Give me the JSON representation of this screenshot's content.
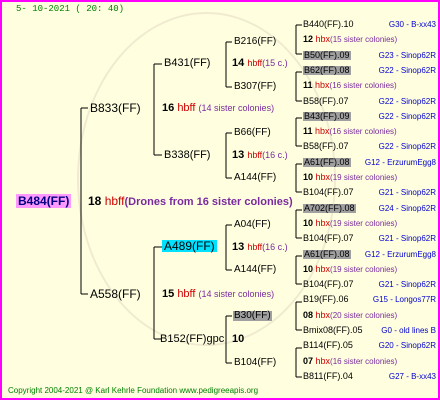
{
  "date": "5- 10-2021 ( 20: 40)",
  "root": {
    "name": "B484(FF)",
    "num": "18",
    "hb": "hbff",
    "note": "(Drones from 16 sister colonies)"
  },
  "g1": [
    {
      "name": "B833(FF)",
      "num": "16",
      "hb": "hbff",
      "note": "(14 sister colonies)"
    },
    {
      "name": "A558(FF)",
      "num": "15",
      "hb": "hbff",
      "note": "(14 sister colonies)"
    }
  ],
  "g2": [
    {
      "name": "B431(FF)",
      "num": "14",
      "hb": "hbff",
      "note": "(15 c.)"
    },
    {
      "name": "B338(FF)",
      "num": "13",
      "hb": "hbff",
      "note": "(16 c.)"
    },
    {
      "name": "A489(FF)",
      "num": "13",
      "hb": "hbff",
      "note": "(16 c.)"
    },
    {
      "name": "B152(FF)gpc",
      "num": "10",
      "hb": "",
      "note": ""
    }
  ],
  "g3": [
    {
      "name": "B216(FF)"
    },
    {
      "name": "B307(FF)"
    },
    {
      "name": "B66(FF)"
    },
    {
      "name": "A144(FF)"
    },
    {
      "name": "A04(FF)"
    },
    {
      "name": "A144(FF)"
    },
    {
      "name": "B30(FF)"
    },
    {
      "name": "B104(FF)"
    }
  ],
  "g4": [
    {
      "name": "B440(FF).10",
      "right": "G30 - B-xx43"
    },
    {
      "num": "12",
      "hb": "hbx",
      "note": "(15 sister colonies)"
    },
    {
      "name": "B50(FF).09",
      "right": "G23 - Sinop62R"
    },
    {
      "name": "B62(FF).08",
      "right": "G22 - Sinop62R"
    },
    {
      "num": "11",
      "hb": "hbx",
      "note": "(16 sister colonies)"
    },
    {
      "name": "B58(FF).07",
      "right": "G22 - Sinop62R"
    },
    {
      "name": "B43(FF).09",
      "right": "G22 - Sinop62R"
    },
    {
      "num": "11",
      "hb": "hbx",
      "note": "(16 sister colonies)"
    },
    {
      "name": "B58(FF).07",
      "right": "G22 - Sinop62R"
    },
    {
      "name": "A61(FF).08",
      "right": "G12 - ErzurumEgg8"
    },
    {
      "num": "10",
      "hb": "hbx",
      "note": "(19 sister colonies)"
    },
    {
      "name": "B104(FF).07",
      "right": "G21 - Sinop62R"
    },
    {
      "name": "A702(FF).08",
      "right": "G24 - Sinop62R"
    },
    {
      "num": "10",
      "hb": "hbx",
      "note": "(19 sister colonies)"
    },
    {
      "name": "B104(FF).07",
      "right": "G21 - Sinop62R"
    },
    {
      "name": "A61(FF).08",
      "right": "G12 - ErzurumEgg8"
    },
    {
      "num": "10",
      "hb": "hbx",
      "note": "(19 sister colonies)"
    },
    {
      "name": "B104(FF).07",
      "right": "G21 - Sinop62R"
    },
    {
      "name": "B19(FF).06",
      "right": "G15 - Longos77R"
    },
    {
      "num": "08",
      "hb": "hbx",
      "note": "(20 sister colonies)"
    },
    {
      "name": "Bmix08(FF).05",
      "right": "G0 - old lines B"
    },
    {
      "name": "B114(FF).05",
      "right": "G20 - Sinop62R"
    },
    {
      "num": "07",
      "hb": "hbx",
      "note": "(16 sister colonies)"
    },
    {
      "name": "B811(FF).04",
      "right": "G27 - B-xx43"
    }
  ],
  "copyright": "Copyright 2004-2021 @ Karl Kehrle Foundation    www.pedigreeapis.org"
}
